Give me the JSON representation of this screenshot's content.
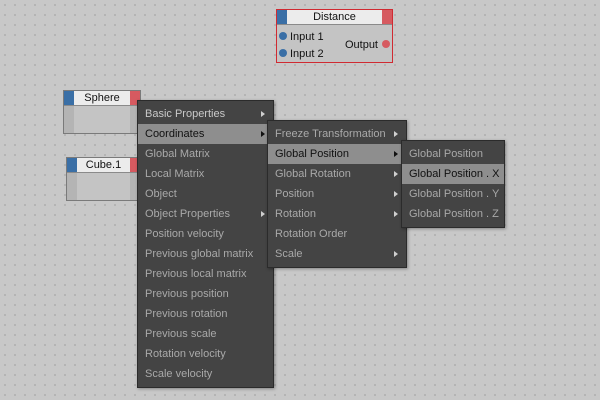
{
  "canvas": {
    "background": "#c8c8c8",
    "accent_in_port": "#3a6fa6",
    "accent_out_port": "#d65a60",
    "selected_border": "#d02a32"
  },
  "nodes": {
    "distance": {
      "title": "Distance",
      "inputs": [
        "Input 1",
        "Input 2"
      ],
      "output": "Output"
    },
    "sphere": {
      "title": "Sphere"
    },
    "cube": {
      "title": "Cube.1"
    }
  },
  "menus": {
    "main": {
      "items": [
        {
          "label": "Basic Properties",
          "submenu": true
        },
        {
          "label": "Coordinates",
          "submenu": true,
          "active": true
        },
        {
          "label": "Global Matrix"
        },
        {
          "label": "Local Matrix"
        },
        {
          "label": "Object"
        },
        {
          "label": "Object Properties",
          "submenu": true
        },
        {
          "label": "Position velocity"
        },
        {
          "label": "Previous global matrix"
        },
        {
          "label": "Previous local matrix"
        },
        {
          "label": "Previous position"
        },
        {
          "label": "Previous rotation"
        },
        {
          "label": "Previous scale"
        },
        {
          "label": "Rotation velocity"
        },
        {
          "label": "Scale velocity"
        }
      ]
    },
    "coordinates": {
      "items": [
        {
          "label": "Freeze Transformation",
          "submenu": true
        },
        {
          "label": "Global Position",
          "submenu": true,
          "active": true
        },
        {
          "label": "Global Rotation",
          "submenu": true
        },
        {
          "label": "Position",
          "submenu": true
        },
        {
          "label": "Rotation",
          "submenu": true
        },
        {
          "label": "Rotation Order"
        },
        {
          "label": "Scale",
          "submenu": true
        }
      ]
    },
    "global_position": {
      "items": [
        {
          "label": "Global Position"
        },
        {
          "label": "Global Position . X",
          "active": true
        },
        {
          "label": "Global Position . Y"
        },
        {
          "label": "Global Position . Z"
        }
      ]
    }
  }
}
